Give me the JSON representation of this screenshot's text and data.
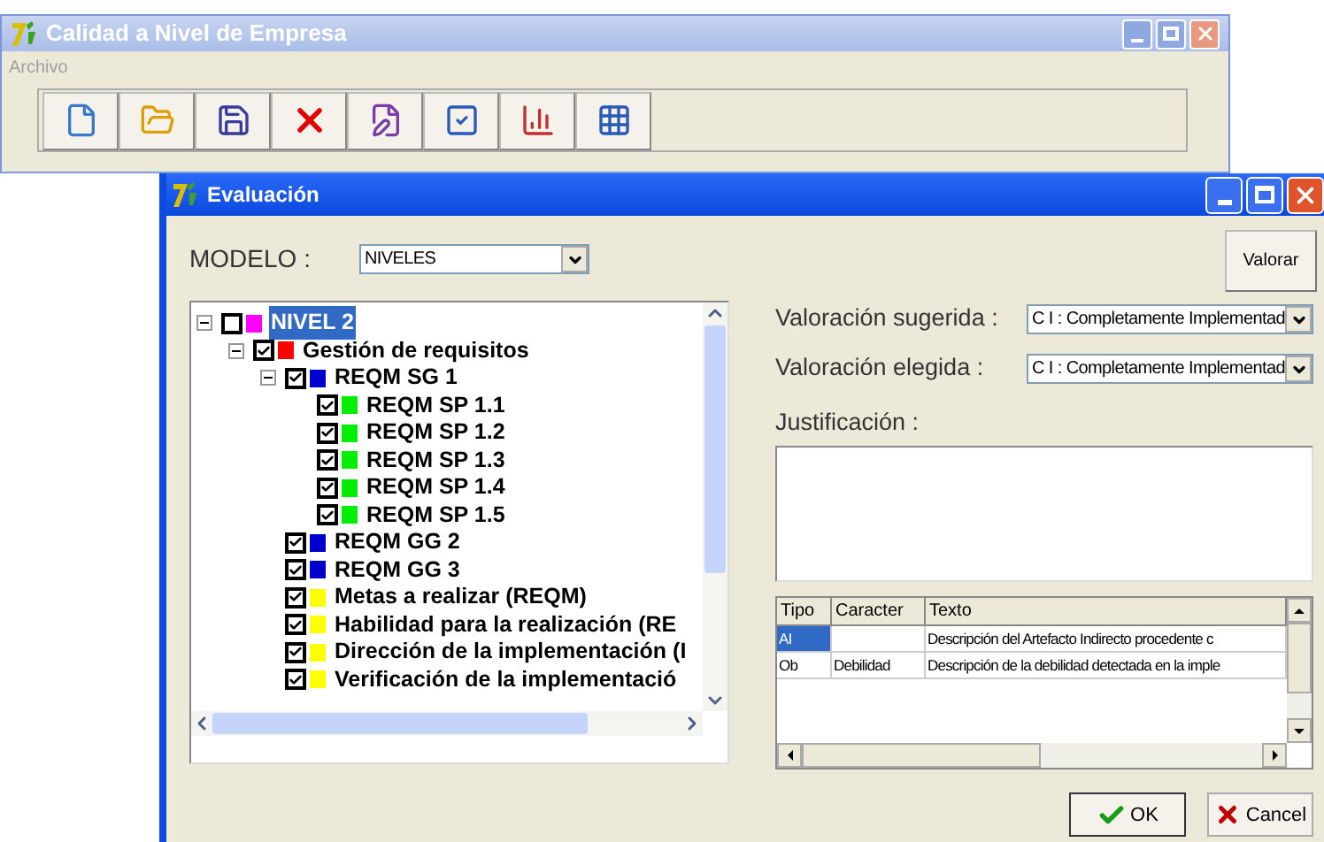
{
  "main_window": {
    "title": "Calidad a Nivel de Empresa",
    "menu": [
      {
        "label": "Archivo",
        "disabled": true
      }
    ],
    "toolbar": [
      {
        "kind": "new"
      },
      {
        "kind": "open"
      },
      {
        "kind": "save"
      },
      {
        "kind": "delete"
      },
      {
        "kind": "edit"
      },
      {
        "kind": "check"
      },
      {
        "kind": "chart"
      },
      {
        "kind": "grid"
      }
    ]
  },
  "dialog": {
    "title": "Evaluación",
    "modelo": {
      "label": "MODELO :",
      "value": "NIVELES"
    },
    "valorar_button": "Valorar",
    "tree": [
      {
        "label": "NIVEL 2",
        "checked": false,
        "selected": true,
        "color": "#ff00ff",
        "expanded": true,
        "children": [
          {
            "label": "Gestión de requisitos",
            "checked": true,
            "selected": false,
            "color": "#ff0000",
            "expanded": true,
            "children": [
              {
                "label": "REQM SG 1",
                "checked": true,
                "selected": false,
                "color": "#0000cc",
                "expanded": true,
                "children": [
                  {
                    "label": "REQM SP 1.1",
                    "checked": true,
                    "selected": false,
                    "color": "#00ee00"
                  },
                  {
                    "label": "REQM SP 1.2",
                    "checked": true,
                    "selected": false,
                    "color": "#00ee00"
                  },
                  {
                    "label": "REQM SP 1.3",
                    "checked": true,
                    "selected": false,
                    "color": "#00ee00"
                  },
                  {
                    "label": "REQM SP 1.4",
                    "checked": true,
                    "selected": false,
                    "color": "#00ee00"
                  },
                  {
                    "label": "REQM SP 1.5",
                    "checked": true,
                    "selected": false,
                    "color": "#00ee00"
                  }
                ]
              },
              {
                "label": "REQM GG 2",
                "checked": true,
                "selected": false,
                "color": "#0000cc"
              },
              {
                "label": "REQM GG 3",
                "checked": true,
                "selected": false,
                "color": "#0000cc"
              },
              {
                "label": "Metas a realizar (REQM)",
                "checked": true,
                "selected": false,
                "color": "#ffff00"
              },
              {
                "label": "Habilidad para la realización (RE",
                "checked": true,
                "selected": false,
                "color": "#ffff00"
              },
              {
                "label": "Dirección de la implementación (I",
                "checked": true,
                "selected": false,
                "color": "#ffff00"
              },
              {
                "label": "Verificación de la implementació",
                "checked": true,
                "selected": false,
                "color": "#ffff00"
              }
            ]
          }
        ]
      }
    ],
    "sugerida": {
      "label": "Valoración sugerida :",
      "value": "C I : Completamente Implementad"
    },
    "elegida": {
      "label": "Valoración elegida :",
      "value": "C I : Completamente Implementad"
    },
    "justificacion": {
      "label": "Justificación :"
    },
    "table": {
      "columns": [
        "Tipo",
        "Caracter",
        "Texto"
      ],
      "rows": [
        {
          "cells": [
            "AI",
            null,
            "Descripción del Artefacto Indirecto procedente c"
          ],
          "selected": true
        },
        {
          "cells": [
            "Ob",
            "Debilidad",
            "Descripción de la debilidad detectada en la imple"
          ],
          "selected": false
        }
      ]
    },
    "buttons": [
      {
        "label": "OK",
        "kind": "ok"
      },
      {
        "label": "Cancel",
        "kind": "cancel"
      }
    ]
  }
}
